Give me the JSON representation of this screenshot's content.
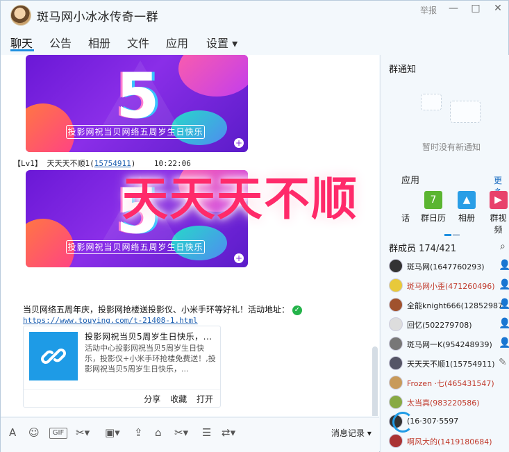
{
  "window": {
    "title": "斑马网小冰冰传奇一群",
    "report_label": "举报",
    "min_label": "—",
    "max_label": "□",
    "close_label": "✕"
  },
  "tabs": [
    {
      "label": "聊天"
    },
    {
      "label": "公告"
    },
    {
      "label": "相册"
    },
    {
      "label": "文件"
    },
    {
      "label": "应用"
    },
    {
      "label": "设置 ▾"
    }
  ],
  "chat": {
    "banner_caption": "投影网祝当贝网络五周岁生日快乐",
    "banner_number": "5",
    "msg_level": "【Lv1】",
    "msg_user": "天天天不顺1",
    "msg_uid": "15754911",
    "msg_time": "10:22:06",
    "text": "当贝网络五周年庆，投影网抢楼送投影仪、小米手环等好礼！活动地址：",
    "link": "https://www.touying.com/t-21408-1.html",
    "card": {
      "title": "投影网祝当贝5周岁生日快乐，...",
      "desc": "活动中心投影网祝当贝5周岁生日快乐，投影仪+小米手环抢楼免费送！,投影网祝当贝5周岁生日快乐，...",
      "share": "分享",
      "collect": "收藏",
      "open": "打开"
    },
    "overlay_text": "天天天不顺"
  },
  "toolbar": {
    "history_label": "消息记录 ▾"
  },
  "right": {
    "notice_title": "群通知",
    "notice_empty": "暂时没有新通知",
    "apps_title": "应用",
    "apps_more": "更多",
    "apps": [
      {
        "label": "话",
        "color": "#7bbd3c",
        "icon": "chat-icon"
      },
      {
        "label": "群日历",
        "color": "#5bb531",
        "icon": "calendar-icon",
        "glyph": "7"
      },
      {
        "label": "相册",
        "color": "#2a9ee6",
        "icon": "photo-icon",
        "glyph": "▲"
      },
      {
        "label": "群视频",
        "color": "#e8426b",
        "icon": "video-icon",
        "glyph": "▶"
      }
    ],
    "members_title": "群成员 174/421",
    "members": [
      {
        "name": "斑马网(1647760293)",
        "red": false,
        "av": "#333"
      },
      {
        "name": "斑马网小歪(471260496)",
        "red": true,
        "av": "#e8c93a"
      },
      {
        "name": "全能knight666(12852987",
        "red": false,
        "av": "#a0522d"
      },
      {
        "name": "回忆(502279708)",
        "red": false,
        "av": "#ddd"
      },
      {
        "name": "斑马网一K(954248939)",
        "red": false,
        "av": "#777"
      },
      {
        "name": "天天天不顺1(15754911)",
        "red": false,
        "av": "#556"
      },
      {
        "name": "Frozen ·七(465431547)",
        "red": true,
        "av": "#c89a5a"
      },
      {
        "name": "太当真(983220586)",
        "red": true,
        "av": "#8a4"
      },
      {
        "name": "(16·307·5597",
        "red": false,
        "av": "#333"
      },
      {
        "name": "啊风大的(1419180684)",
        "red": true,
        "av": "#a33"
      }
    ]
  }
}
